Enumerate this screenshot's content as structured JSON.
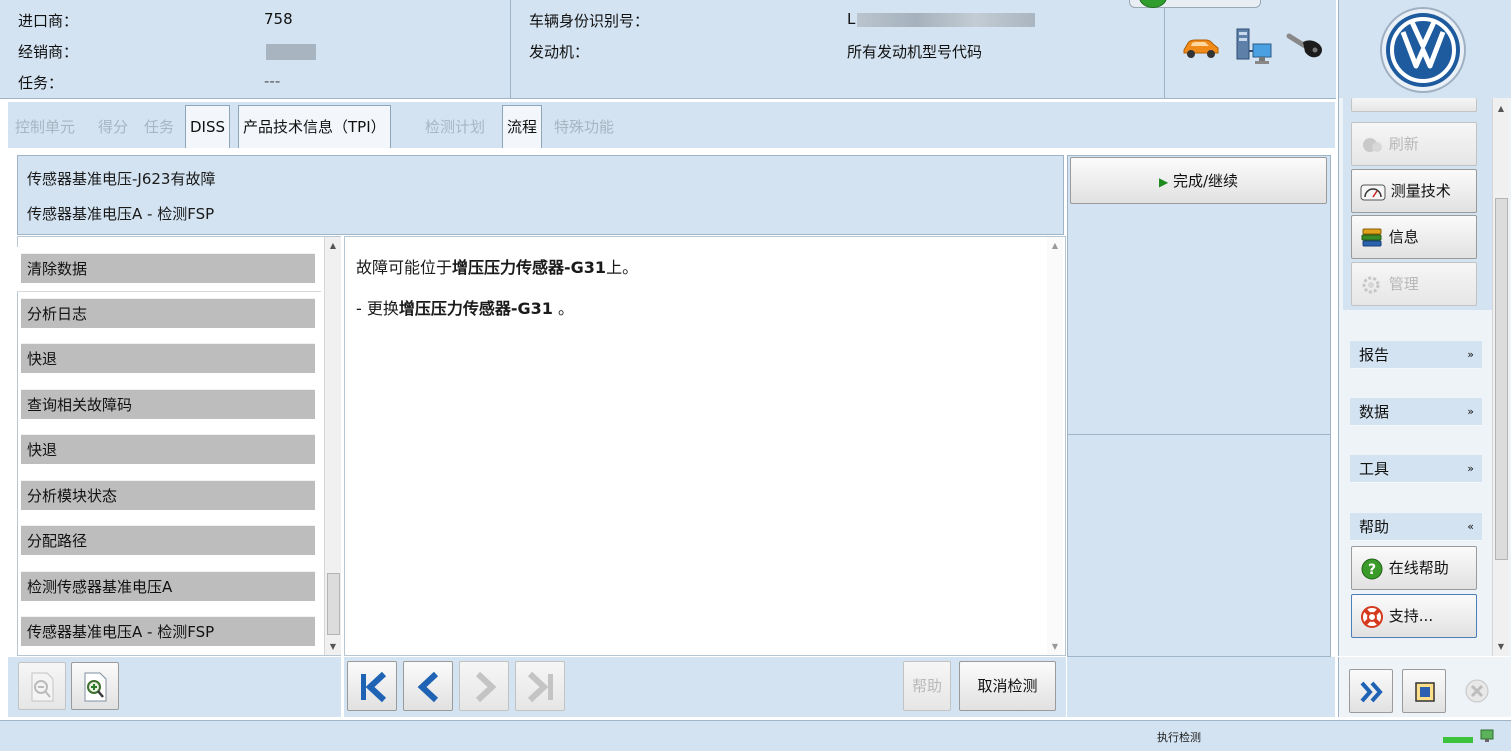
{
  "header": {
    "importer_label": "进口商：",
    "importer_value": "758",
    "dealer_label": "经销商：",
    "task_label": "任务：",
    "task_value": "---",
    "vin_label": "车辆身份识别号：",
    "vin_value": "L",
    "engine_label": "发动机：",
    "engine_value": "所有发动机型号代码"
  },
  "tabs": [
    {
      "label": "控制单元",
      "active": false
    },
    {
      "label": "得分",
      "active": false
    },
    {
      "label": "任务",
      "active": false
    },
    {
      "label": "DISS",
      "active": true
    },
    {
      "label": "产品技术信息（TPI）",
      "active": true
    },
    {
      "label": "检测计划",
      "active": false
    },
    {
      "label": "流程",
      "active": true
    },
    {
      "label": "特殊功能",
      "active": false
    }
  ],
  "title_panel": {
    "line1": "传感器基准电压-J623有故障",
    "line2": "传感器基准电压A - 检测FSP"
  },
  "steps": [
    "清除数据",
    "分析日志",
    "快退",
    "查询相关故障码",
    "快退",
    "分析模块状态",
    "分配路径",
    "检测传感器基准电压A",
    "传感器基准电压A - 检测FSP"
  ],
  "content": {
    "line1_prefix": "故障可能位于",
    "line1_bold": "增压压力传感器-G31",
    "line1_suffix": "上。",
    "line2_prefix": "- 更换",
    "line2_bold": "增压压力传感器-G31",
    "line2_suffix": " 。"
  },
  "buttons": {
    "complete": "完成/继续",
    "help": "帮助",
    "cancel": "取消检测"
  },
  "sidebar": {
    "refresh": "刷新",
    "measure": "测量技术",
    "info": "信息",
    "manage": "管理",
    "sections": [
      {
        "label": "报告",
        "chevron": "»",
        "expanded": false
      },
      {
        "label": "数据",
        "chevron": "»",
        "expanded": false
      },
      {
        "label": "工具",
        "chevron": "»",
        "expanded": false
      },
      {
        "label": "帮助",
        "chevron": "«",
        "expanded": true
      }
    ],
    "online_help": "在线帮助",
    "support": "支持..."
  },
  "status": {
    "text": "执行检测"
  },
  "colors": {
    "panel": "#d3e3f1",
    "step_button": "#bdbdbd",
    "nav_blue": "#1f63b5",
    "play_green": "#1c8a1c"
  }
}
